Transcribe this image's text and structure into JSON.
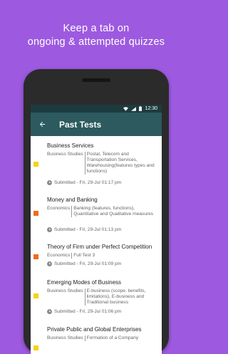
{
  "promo": {
    "line1": "Keep a tab on",
    "line2": "ongoing & attempted quizzes"
  },
  "status_bar": {
    "time": "12:30"
  },
  "app_bar": {
    "title": "Past Tests"
  },
  "tests": [
    {
      "title": "Business Services",
      "subject": "Business Studies",
      "topic": "Postal, Telecom and Transportation Services, Warehousing(features types and functions)",
      "submitted": "Submitted - Fri, 29-Jul 01:17 pm",
      "marker_color": "#f5d40f"
    },
    {
      "title": "Money and Banking",
      "subject": "Economics",
      "topic": "Banking (features, functions), Quantitative and Qualitative measures",
      "submitted": "Submitted - Fri, 29-Jul 01:13 pm",
      "marker_color": "#ef6c1a"
    },
    {
      "title": "Theory of Firm under Perfect Competition",
      "subject": "Economics",
      "topic": "Full Test 3",
      "submitted": "Submitted - Fri, 29-Jul 01:09 pm",
      "marker_color": "#ef6c1a"
    },
    {
      "title": "Emerging Modes of Business",
      "subject": "Business Studies",
      "topic": "E-business (scope, benefits, limitations), E-business and Traditional business",
      "submitted": "Submitted - Fri, 29-Jul 01:06 pm",
      "marker_color": "#f5d40f"
    },
    {
      "title": "Private Public and Global Enterprises",
      "subject": "Business Studies",
      "topic": "Formation of a Company",
      "submitted": "",
      "marker_color": "#f5d40f"
    }
  ]
}
